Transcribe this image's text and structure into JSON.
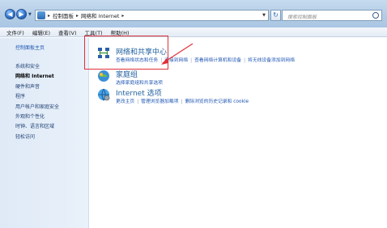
{
  "toolbar": {
    "back_label": "◀",
    "forward_label": "▶",
    "address": {
      "crumbs": [
        "控制面板",
        "网络和 Internet"
      ]
    },
    "search_placeholder": "搜索控制面板"
  },
  "menubar": {
    "items": [
      "文件(F)",
      "编辑(E)",
      "查看(V)",
      "工具(T)",
      "帮助(H)"
    ]
  },
  "sidebar": {
    "home": "控制面板主页",
    "items": [
      "系统和安全",
      "网络和 Internet",
      "硬件和声音",
      "程序",
      "用户帐户和家庭安全",
      "外观和个性化",
      "时钟、语言和区域",
      "轻松访问"
    ]
  },
  "main": {
    "categories": [
      {
        "title": "网络和共享中心",
        "links": [
          "查看网络状态和任务",
          "连接到网络",
          "查看网络计算机和设备",
          "将无线设备添加到网络"
        ]
      },
      {
        "title": "家庭组",
        "links": [
          "选择家庭组和共享选项"
        ]
      },
      {
        "title": "Internet 选项",
        "links": [
          "更改主页",
          "管理浏览器加载项",
          "删除浏览的历史记录和 cookie"
        ]
      }
    ]
  },
  "colors": {
    "link": "#1f56b3",
    "category_title": "#1e5f9f",
    "highlight": "#e0303a"
  }
}
